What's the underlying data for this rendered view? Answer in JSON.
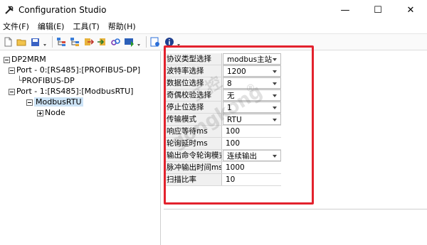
{
  "window": {
    "title": "Configuration Studio",
    "minimize": "—",
    "maximize": "☐",
    "close": "✕"
  },
  "menu": [
    "文件(F)",
    "编辑(E)",
    "工具(T)",
    "帮助(H)"
  ],
  "tree": {
    "root": "DP2MRM",
    "port0": "Port - 0:[RS485]:[PROFIBUS-DP]",
    "profibus": "PROFIBUS-DP",
    "port1": "Port - 1:[RS485]:[ModbusRTU]",
    "modbus": "ModbusRTU",
    "node": "Node"
  },
  "properties": [
    {
      "name": "协议类型选择",
      "value": "modbus主站",
      "type": "combo"
    },
    {
      "name": "波特率选择",
      "value": "1200",
      "type": "combo"
    },
    {
      "name": "数据位选择",
      "value": "8",
      "type": "combo"
    },
    {
      "name": "奇偶校验选择",
      "value": "无",
      "type": "combo"
    },
    {
      "name": "停止位选择",
      "value": "1",
      "type": "combo"
    },
    {
      "name": "传输模式",
      "value": "RTU",
      "type": "combo"
    },
    {
      "name": "响应等待ms",
      "value": "100",
      "type": "text"
    },
    {
      "name": "轮询延时ms",
      "value": "100",
      "type": "text"
    },
    {
      "name": "输出命令轮询模式",
      "value": "连续输出",
      "type": "combo"
    },
    {
      "name": "脉冲输出时间ms",
      "value": "1000",
      "type": "text"
    },
    {
      "name": "扫描比率",
      "value": "10",
      "type": "text"
    }
  ],
  "watermark": {
    "line1": "gongkong",
    "line2": "工控",
    "mark": "®"
  },
  "colors": {
    "highlight": "#e3222d",
    "selection": "#cde4f7"
  }
}
